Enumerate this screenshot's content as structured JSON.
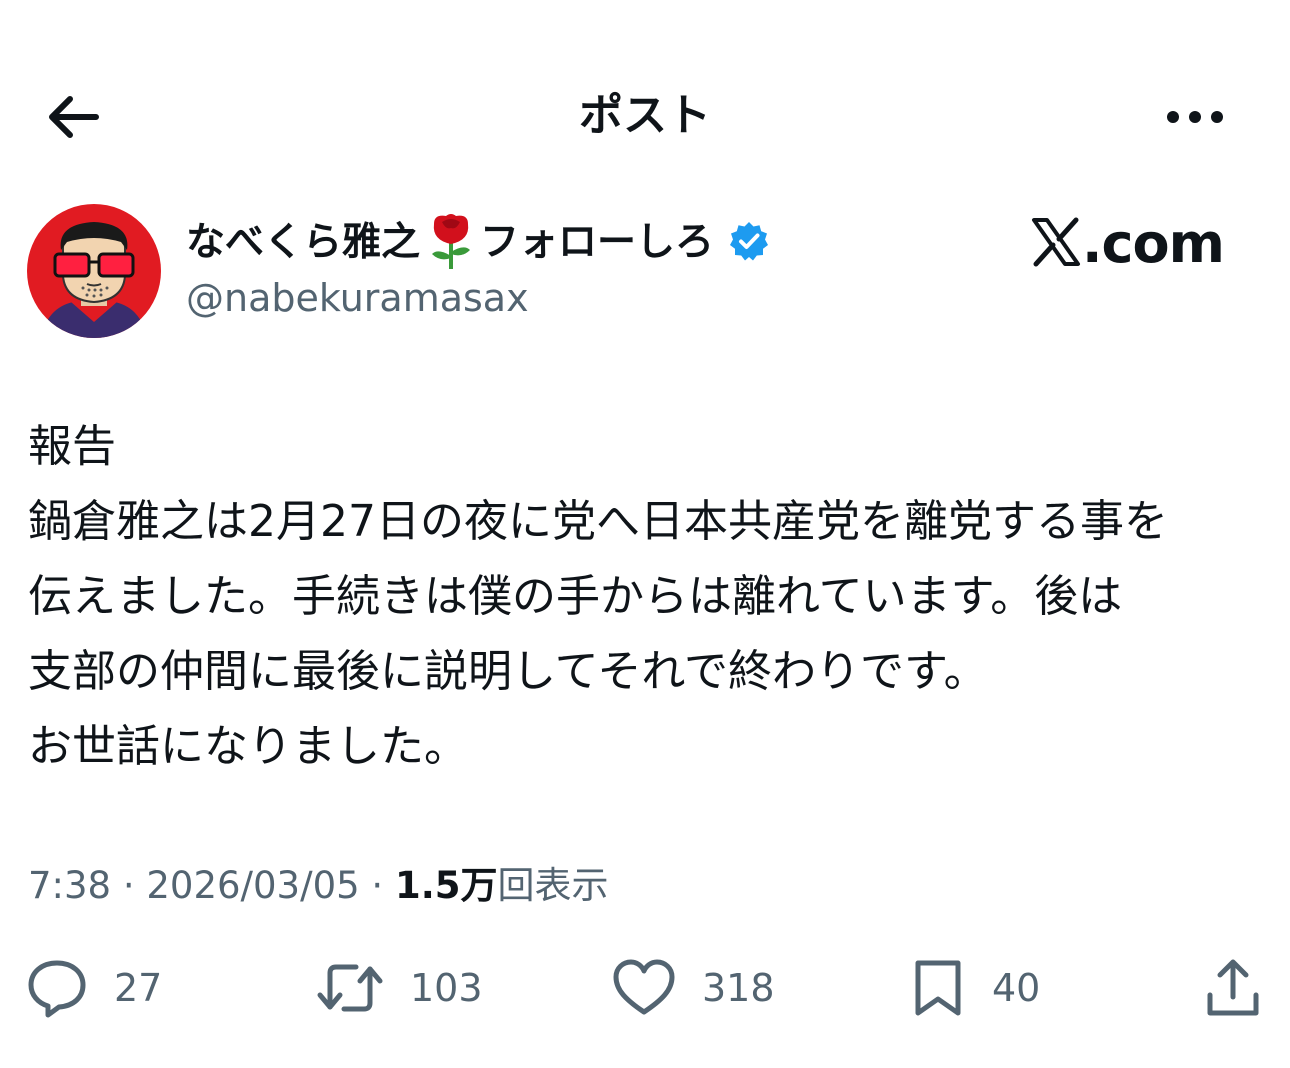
{
  "header": {
    "title": "ポスト"
  },
  "author": {
    "name_part1": "なべくら雅之",
    "name_emoji": "🌹",
    "name_part2": "フォローしろ",
    "handle": "@nabekuramasax",
    "verified": true
  },
  "brand": {
    "logo_letter": "X",
    "domain": ".com"
  },
  "post": {
    "lines": [
      "報告",
      "鍋倉雅之は2月27日の夜に党へ日本共産党を離党する事を",
      "伝えました。手続きは僕の手からは離れています。後は",
      "支部の仲間に最後に説明してそれで終わりです。",
      "お世話になりました。"
    ]
  },
  "meta": {
    "time": "7:38",
    "separator": "·",
    "date": "2026/03/05",
    "views_count": "1.5万",
    "views_label": "回表示"
  },
  "actions": {
    "reply": "27",
    "repost": "103",
    "like": "318",
    "bookmark": "40"
  },
  "colors": {
    "text": "#0f1419",
    "secondary": "#536471",
    "verified": "#1d9bf0",
    "avatar_bg": "#e11b22"
  },
  "icons": {
    "back": "arrow-left-icon",
    "more": "more-horizontal-icon",
    "verified": "verified-badge-icon",
    "reply": "reply-icon",
    "repost": "repost-icon",
    "like": "heart-icon",
    "bookmark": "bookmark-icon",
    "share": "share-icon"
  }
}
